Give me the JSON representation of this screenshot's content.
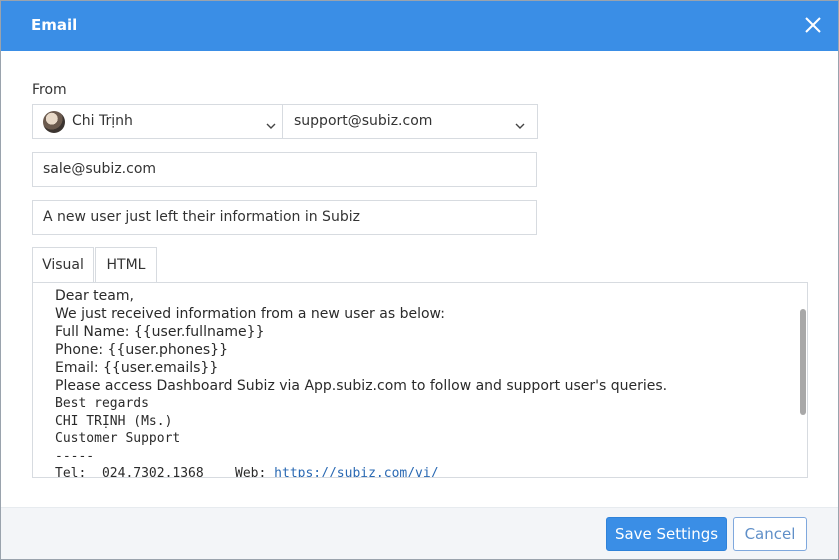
{
  "dialog": {
    "title": "Email",
    "close_icon": "close-icon"
  },
  "from": {
    "label": "From",
    "sender_name": "Chi Trịnh",
    "sender_address": "support@subiz.com"
  },
  "to": {
    "value": "sale@subiz.com"
  },
  "subject": {
    "value": "A new user just left their information in Subiz"
  },
  "tabs": [
    {
      "label": "Visual"
    },
    {
      "label": "HTML"
    }
  ],
  "body": {
    "lines": [
      "Dear team,",
      "We just received information from a new user as below:",
      "Full Name: {{user.fullname}}",
      "Phone: {{user.phones}}",
      "Email: {{user.emails}}",
      "Please access Dashboard Subiz via App.subiz.com to follow and support user's queries."
    ],
    "signature": {
      "regards": "Best regards",
      "name": "CHI TRỊNH (Ms.)",
      "role": "Customer Support",
      "separator": "-----",
      "tel_label": "Tel:",
      "tel_value": "024.7302.1368",
      "web_label": "Web:",
      "web_link": "https://subiz.com/vi/"
    }
  },
  "footer": {
    "save_label": "Save Settings",
    "cancel_label": "Cancel"
  },
  "colors": {
    "accent": "#3a8ee6",
    "link": "#2a69b3",
    "footer_bg": "#f3f5f8"
  }
}
